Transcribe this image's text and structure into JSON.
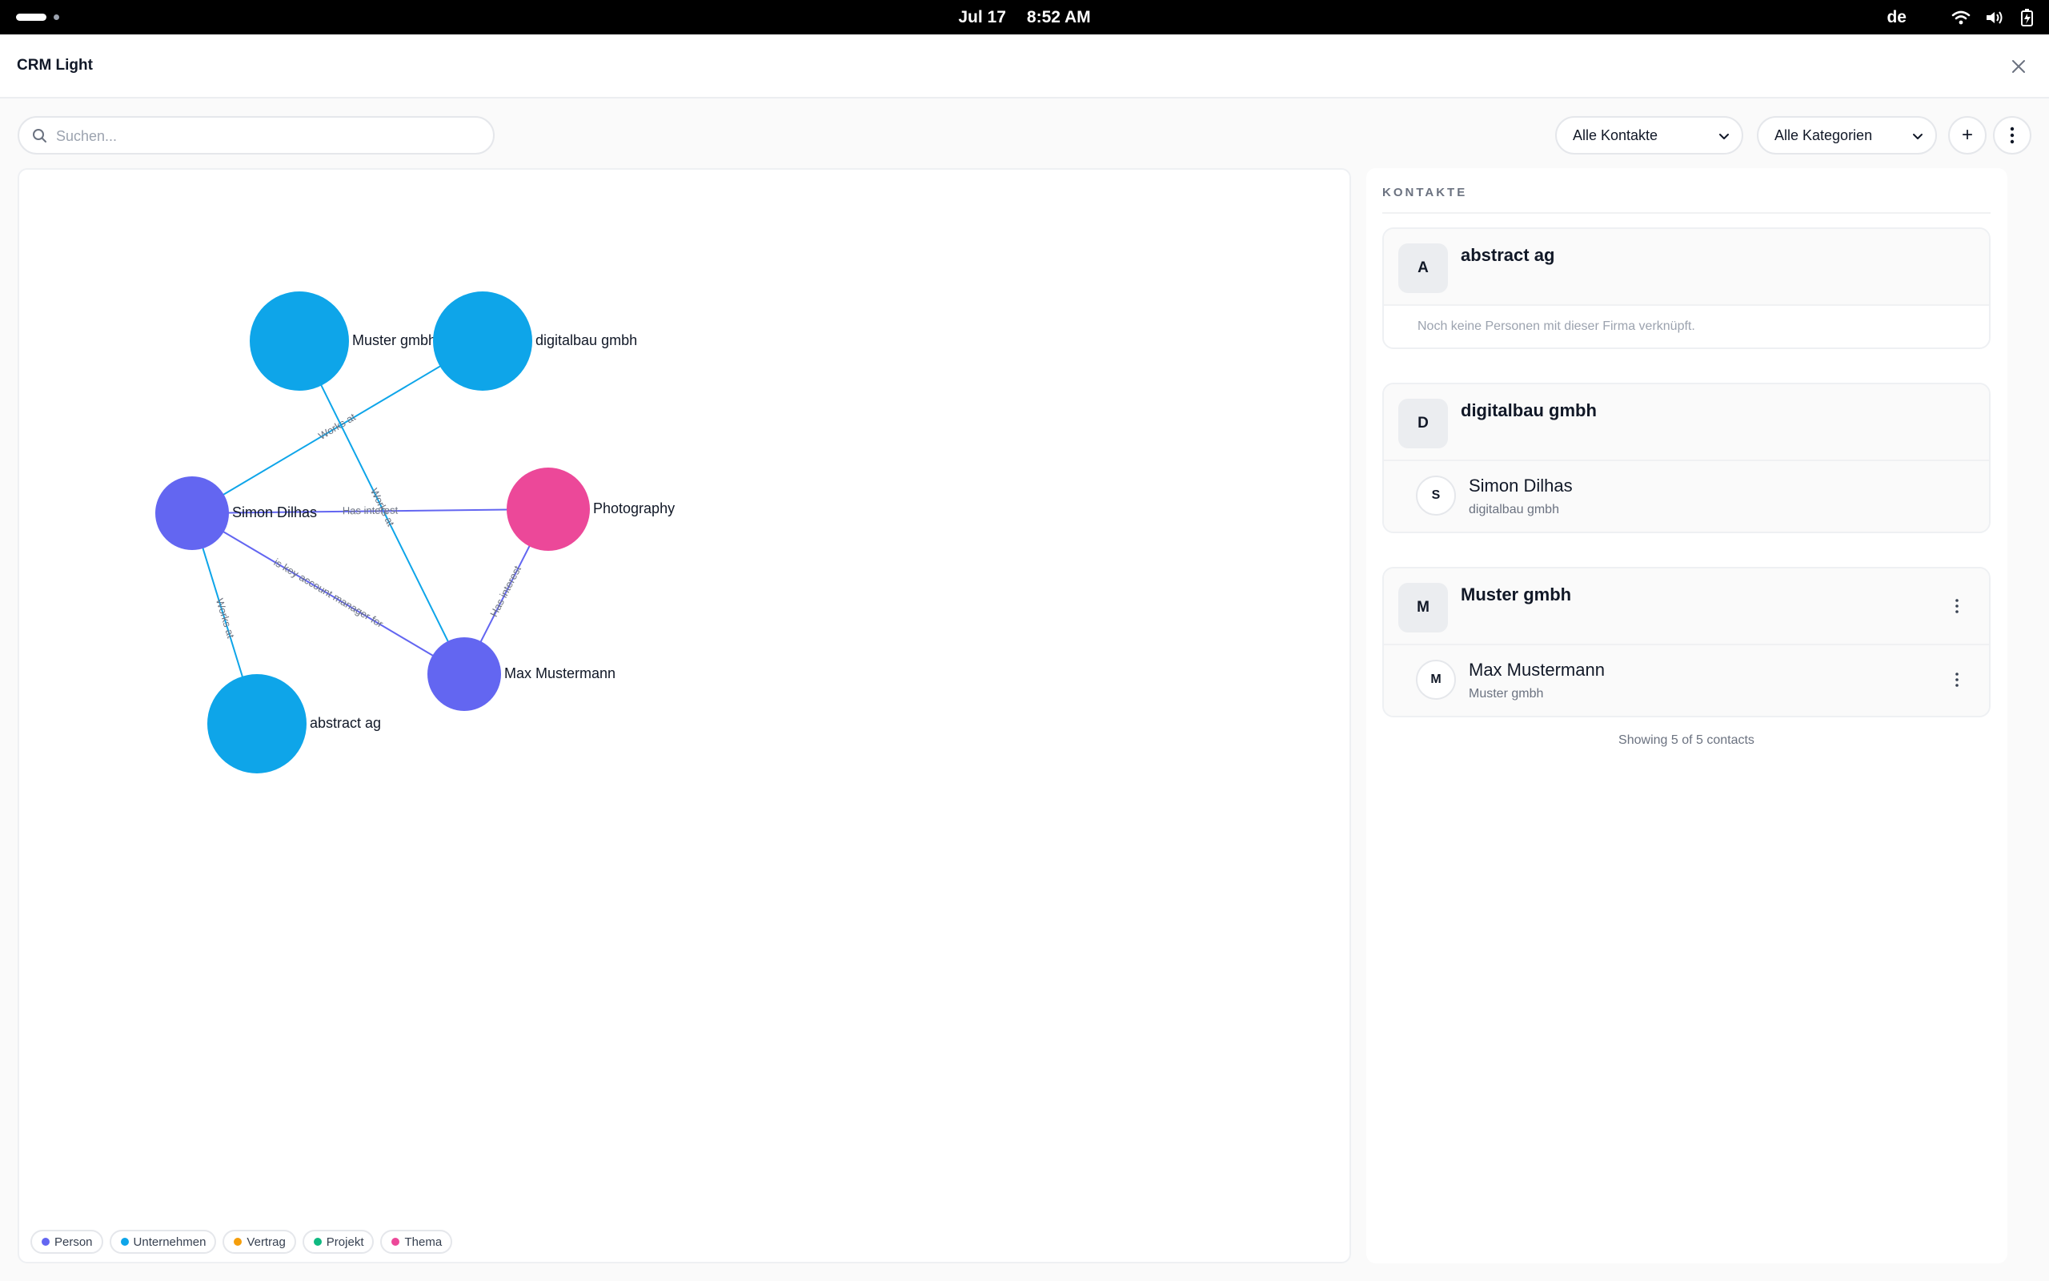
{
  "status_bar": {
    "date": "Jul 17",
    "time": "8:52 AM",
    "language": "de"
  },
  "app": {
    "title": "CRM Light"
  },
  "toolbar": {
    "search_placeholder": "Suchen...",
    "filter_contacts": "Alle Kontakte",
    "filter_categories": "Alle Kategorien",
    "add_label": "+"
  },
  "graph": {
    "nodes": [
      {
        "id": "muster",
        "label": "Muster gmbh",
        "type": "Unternehmen"
      },
      {
        "id": "digitalbau",
        "label": "digitalbau gmbh",
        "type": "Unternehmen"
      },
      {
        "id": "simon",
        "label": "Simon Dilhas",
        "type": "Person"
      },
      {
        "id": "photography",
        "label": "Photography",
        "type": "Thema"
      },
      {
        "id": "max",
        "label": "Max Mustermann",
        "type": "Person"
      },
      {
        "id": "abstract",
        "label": "abstract ag",
        "type": "Unternehmen"
      }
    ],
    "edges": [
      {
        "from": "simon",
        "to": "digitalbau",
        "label": "Works at"
      },
      {
        "from": "max",
        "to": "muster",
        "label": "Works at"
      },
      {
        "from": "simon",
        "to": "photography",
        "label": "Has interest"
      },
      {
        "from": "simon",
        "to": "max",
        "label": "is key account manager for"
      },
      {
        "from": "max",
        "to": "photography",
        "label": "Has interest"
      },
      {
        "from": "simon",
        "to": "abstract",
        "label": "Works at"
      }
    ],
    "legend": [
      {
        "label": "Person",
        "color": "#6366f1"
      },
      {
        "label": "Unternehmen",
        "color": "#0ea5e9"
      },
      {
        "label": "Vertrag",
        "color": "#f59e0b"
      },
      {
        "label": "Projekt",
        "color": "#10b981"
      },
      {
        "label": "Thema",
        "color": "#ec4899"
      }
    ]
  },
  "contacts": {
    "heading": "KONTAKTE",
    "companies": [
      {
        "initial": "A",
        "name": "abstract ag",
        "empty_note": "Noch keine Personen mit dieser Firma verknüpft.",
        "people": []
      },
      {
        "initial": "D",
        "name": "digitalbau gmbh",
        "people": [
          {
            "initial": "S",
            "name": "Simon Dilhas",
            "company": "digitalbau gmbh"
          }
        ]
      },
      {
        "initial": "M",
        "name": "Muster gmbh",
        "people": [
          {
            "initial": "M",
            "name": "Max Mustermann",
            "company": "Muster gmbh"
          }
        ]
      }
    ],
    "footer": "Showing 5 of 5 contacts"
  }
}
